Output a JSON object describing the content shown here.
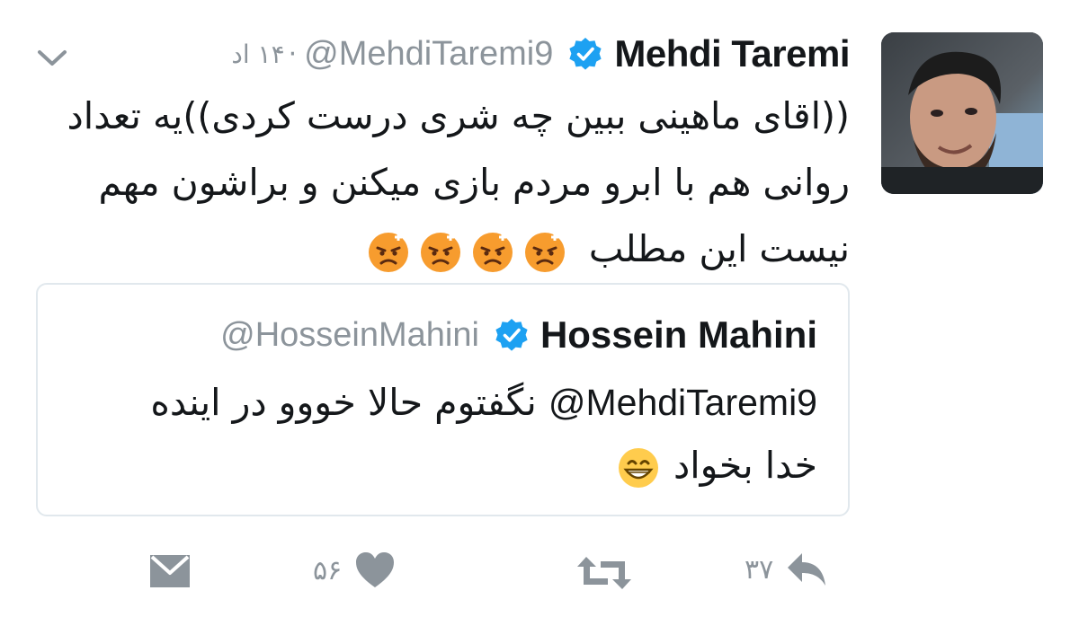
{
  "tweet": {
    "author": {
      "display_name": "Mehdi Taremi",
      "handle": "@MehdiTaremi9",
      "verified": true
    },
    "separator": "·",
    "date": "۱۴ اد",
    "text": "((اقای ماهینی ببین چه شری درست کردی))یه تعداد روانی هم با ابرو مردم بازی میکنن و براشون مهم نیست این مطلب",
    "emoji": [
      "angry-face-emoji",
      "angry-face-emoji",
      "angry-face-emoji",
      "angry-face-emoji"
    ]
  },
  "quoted_tweet": {
    "author": {
      "display_name": "Hossein Mahini",
      "handle": "@HosseinMahini",
      "verified": true
    },
    "mention": "@MehdiTaremi9",
    "text": "نگفتوم حالا خووو در اینده خدا بخواد",
    "emoji": [
      "grinning-face-emoji"
    ]
  },
  "actions": {
    "reply_count": "۳۷",
    "retweet_count": "",
    "like_count": "۵۶",
    "icons": {
      "reply": "reply-icon",
      "retweet": "retweet-icon",
      "like": "heart-icon",
      "dm": "envelope-icon",
      "menu": "chevron-down-icon"
    }
  },
  "colors": {
    "verified_blue": "#1da1f2",
    "muted_gray": "#8c949b",
    "text_dark": "#14171a",
    "border": "#e1e8ed"
  }
}
